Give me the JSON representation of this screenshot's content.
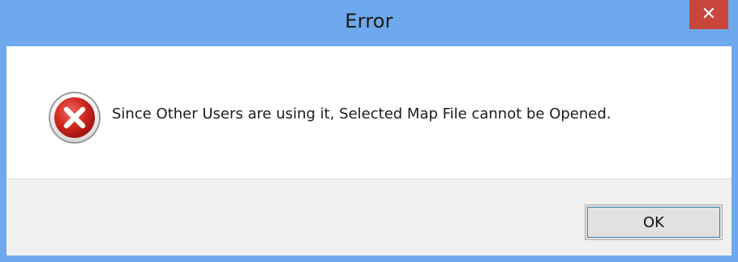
{
  "window": {
    "title": "Error",
    "close_glyph": "✕",
    "close_icon": "close-icon"
  },
  "message": {
    "icon": "error-icon",
    "text": "Since Other Users are using it, Selected Map File cannot be Opened."
  },
  "buttons": {
    "ok_label": "OK"
  },
  "colors": {
    "titlebar": "#6da9ec",
    "close_button": "#c9463d",
    "error_icon": "#c8201e",
    "button_bar": "#f0f0f0"
  }
}
